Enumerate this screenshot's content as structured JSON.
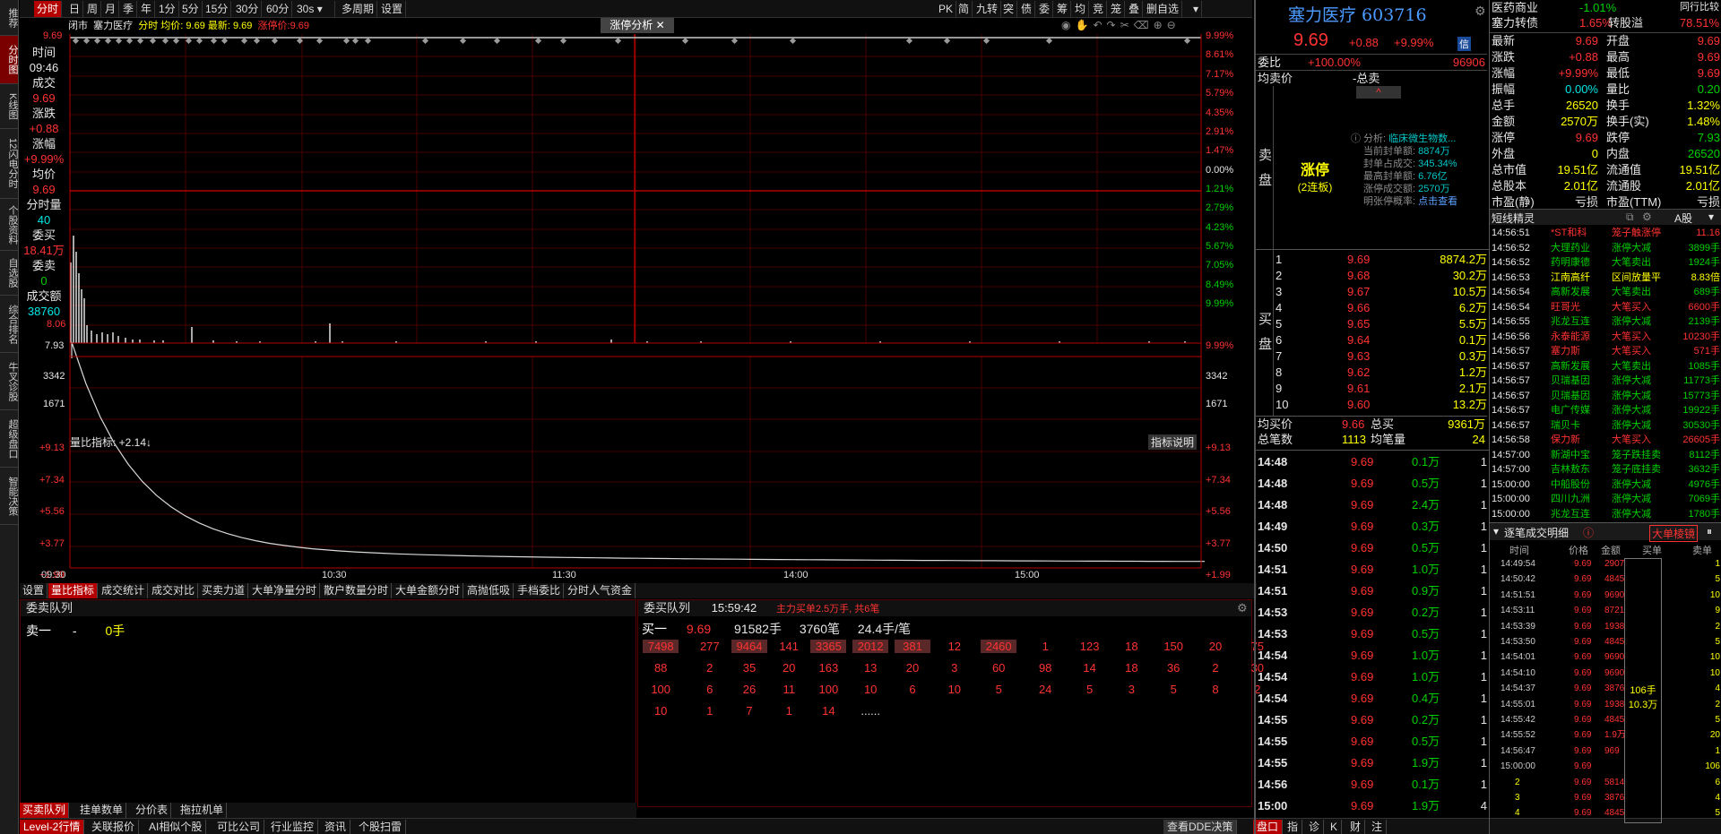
{
  "left_sidebar": [
    "推荐",
    "分时图",
    "K线图",
    "12闪电分时",
    "个股资料",
    "自选股",
    "综合排名",
    "牛叉诊股",
    "超级盘口",
    "智能决策"
  ],
  "toolbar": {
    "periods": [
      "分时",
      "日",
      "周",
      "月",
      "季",
      "年",
      "1分",
      "5分",
      "15分",
      "30分",
      "60分",
      "30s",
      "多周期",
      "设置"
    ],
    "active": "分时",
    "right": [
      "PK",
      "简",
      "九转",
      "突",
      "债",
      "委",
      "筹",
      "均",
      "竞",
      "笼",
      "叠",
      "删自选"
    ]
  },
  "chart_header": {
    "market": "闭市",
    "name": "塞力医疗",
    "items": "分时 均价: 9.69 最新: 9.69",
    "limit": "涨停价:9.69",
    "badge": "涨停分析"
  },
  "cursor_panel": {
    "time_label": "时间",
    "time": "09:46",
    "deal_label": "成交",
    "deal": "9.69",
    "chg_label": "涨跌",
    "chg": "+0.88",
    "pct_label": "涨幅",
    "pct": "+9.99%",
    "avg_label": "均价",
    "avg": "9.69",
    "vol_label": "分时量",
    "vol": "40",
    "buyq_label": "委买",
    "buyq": "18.41万",
    "sellq_label": "委卖",
    "sellq": "0",
    "amt_label": "成交额",
    "amt": "38760"
  },
  "price_axis_left": [
    "9.69",
    "8.06"
  ],
  "price_axis_right": [
    "9.99%",
    "8.61%",
    "7.17%",
    "5.79%",
    "4.35%",
    "2.91%",
    "1.47%",
    "0.00%",
    "1.21%",
    "2.79%",
    "4.23%",
    "5.67%",
    "7.05%",
    "8.49%",
    "9.99%"
  ],
  "volume_axis": [
    "7.93",
    "3342",
    "1671"
  ],
  "volume_axis_right": [
    "9.99%",
    "3342",
    "1671"
  ],
  "indicator": {
    "label": "量比指标: +2.14↓",
    "help": "指标说明",
    "levels": [
      "+9.13",
      "+7.34",
      "+5.56",
      "+3.77",
      "+1.99"
    ]
  },
  "time_axis": [
    "09:30",
    "10:30",
    "11:30",
    "14:00",
    "15:00"
  ],
  "chart_data": {
    "type": "line",
    "x": [
      "09:30",
      "10:30",
      "11:30",
      "14:00",
      "15:00"
    ],
    "series": [
      {
        "values": [
          9.69,
          9.69,
          9.69,
          9.69,
          9.69
        ]
      }
    ],
    "ylim": [
      8.06,
      9.69
    ],
    "grid": true
  },
  "indicator_tabs": [
    "设置",
    "量比指标",
    "成交统计",
    "成交对比",
    "买卖力道",
    "大单净量分时",
    "散户数量分时",
    "大单金额分时",
    "高抛低吸",
    "手档委比",
    "分时人气资金"
  ],
  "sell_queue": {
    "title": "委卖队列",
    "row_label": "卖一",
    "price": "-",
    "qty": "0手"
  },
  "buy_queue": {
    "title": "委买队列",
    "time": "15:59:42",
    "note": "主力买单2.5万手, 共6笔",
    "head": [
      "买一",
      "9.69",
      "91582手",
      "3760笔",
      "24.4手/笔"
    ],
    "rows": [
      [
        "7498",
        "277",
        "9464",
        "141",
        "3365",
        "2012",
        "381",
        "12",
        "2460",
        "1",
        "123",
        "18",
        "150",
        "20",
        "75"
      ],
      [
        "88",
        "2",
        "35",
        "20",
        "163",
        "13",
        "20",
        "3",
        "60",
        "98",
        "14",
        "18",
        "36",
        "2",
        "30"
      ],
      [
        "100",
        "6",
        "26",
        "11",
        "100",
        "10",
        "6",
        "10",
        "5",
        "24",
        "5",
        "3",
        "5",
        "8",
        "2"
      ],
      [
        "10",
        "1",
        "7",
        "1",
        "14",
        "......"
      ]
    ]
  },
  "bottom_tabs": [
    "买卖队列",
    "挂单数单",
    "分价表",
    "拖拉机单"
  ],
  "status_bar": [
    "Level-2行情",
    "关联报价",
    "AI相似个股",
    "可比公司",
    "行业监控",
    "资讯",
    "个股扫雷"
  ],
  "status_right": [
    "查看DDE决策",
    "盘口",
    "指",
    "诊",
    "K",
    "财",
    "注"
  ],
  "quote": {
    "name": "塞力医疗 603716",
    "price": "9.69",
    "chg": "+0.88",
    "pct": "+9.99%",
    "tag": "信",
    "weibi_label": "委比",
    "weibi": "+100.00%",
    "weicha": "96906",
    "jmj_label": "均卖价",
    "total_sell": "-总卖",
    "limit_up": "涨停",
    "limit_days": "(2连板)",
    "analysis": [
      [
        "分析:",
        "临床微生物数..."
      ],
      [
        "当前封单额:",
        "8874万"
      ],
      [
        "封单占成交:",
        "345.34%"
      ],
      [
        "最高封单额:",
        "6.76亿"
      ],
      [
        "涨停成交额:",
        "2570万"
      ],
      [
        "明张停概率:",
        "点击查看"
      ]
    ],
    "sell_side_label": "卖盘",
    "buy_side_label": "买盘",
    "buys": [
      [
        "1",
        "9.69",
        "8874.2万"
      ],
      [
        "2",
        "9.68",
        "30.2万"
      ],
      [
        "3",
        "9.67",
        "10.5万"
      ],
      [
        "4",
        "9.66",
        "6.2万"
      ],
      [
        "5",
        "9.65",
        "5.5万"
      ],
      [
        "6",
        "9.64",
        "0.1万"
      ],
      [
        "7",
        "9.63",
        "0.3万"
      ],
      [
        "8",
        "9.62",
        "1.2万"
      ],
      [
        "9",
        "9.61",
        "2.1万"
      ],
      [
        "10",
        "9.60",
        "13.2万"
      ]
    ],
    "avg_buy_label": "均买价",
    "avg_buy": "9.66",
    "total_buy_label": "总买",
    "total_buy": "9361万",
    "deals_label": "总笔数",
    "deals": "1113",
    "avg_vol_label": "均笔量",
    "avg_vol": "24",
    "ticks": [
      [
        "14:48",
        "9.69",
        "0.1万",
        "1"
      ],
      [
        "14:48",
        "9.69",
        "0.5万",
        "1"
      ],
      [
        "14:48",
        "9.69",
        "2.4万",
        "1"
      ],
      [
        "14:49",
        "9.69",
        "0.3万",
        "1"
      ],
      [
        "14:50",
        "9.69",
        "0.5万",
        "1"
      ],
      [
        "14:51",
        "9.69",
        "1.0万",
        "1"
      ],
      [
        "14:51",
        "9.69",
        "0.9万",
        "1"
      ],
      [
        "14:53",
        "9.69",
        "0.2万",
        "1"
      ],
      [
        "14:53",
        "9.69",
        "0.5万",
        "1"
      ],
      [
        "14:54",
        "9.69",
        "1.0万",
        "1"
      ],
      [
        "14:54",
        "9.69",
        "1.0万",
        "1"
      ],
      [
        "14:54",
        "9.69",
        "0.4万",
        "1"
      ],
      [
        "14:55",
        "9.69",
        "0.2万",
        "1"
      ],
      [
        "14:55",
        "9.69",
        "0.5万",
        "1"
      ],
      [
        "14:55",
        "9.69",
        "1.9万",
        "1"
      ],
      [
        "14:56",
        "9.69",
        "0.1万",
        "1"
      ],
      [
        "15:00",
        "9.69",
        "1.9万",
        "4"
      ]
    ]
  },
  "stats": {
    "top": [
      [
        "医药商业",
        "-1.01%",
        "同行比较"
      ],
      [
        "塞力转债",
        "1.65%",
        "转股溢",
        "78.51%"
      ]
    ],
    "rows": [
      [
        "最新",
        "9.69",
        "开盘",
        "9.69"
      ],
      [
        "涨跌",
        "+0.88",
        "最高",
        "9.69"
      ],
      [
        "涨幅",
        "+9.99%",
        "最低",
        "9.69"
      ],
      [
        "振幅",
        "0.00%",
        "量比",
        "0.20"
      ],
      [
        "总手",
        "26520",
        "换手",
        "1.32%"
      ],
      [
        "金额",
        "2570万",
        "换手(实)",
        "1.48%"
      ],
      [
        "涨停",
        "9.69",
        "跌停",
        "7.93"
      ],
      [
        "外盘",
        "0",
        "内盘",
        "26520"
      ],
      [
        "总市值",
        "19.51亿",
        "流通值",
        "19.51亿"
      ],
      [
        "总股本",
        "2.01亿",
        "流通股",
        "2.01亿"
      ],
      [
        "市盈(静)",
        "亏损",
        "市盈(TTM)",
        "亏损"
      ]
    ]
  },
  "short_wizard": {
    "title": "短线精灵",
    "filter": "A股",
    "rows": [
      [
        "14:56:51",
        "*ST和科",
        "笼子触涨停",
        "11.16"
      ],
      [
        "14:56:52",
        "大理药业",
        "涨停大减",
        "3899手"
      ],
      [
        "14:56:52",
        "药明康德",
        "大笔卖出",
        "1924手"
      ],
      [
        "14:56:53",
        "江南高纤",
        "区间放量平",
        "8.83倍"
      ],
      [
        "14:56:54",
        "高新发展",
        "大笔卖出",
        "689手"
      ],
      [
        "14:56:54",
        "旺哥光",
        "大笔买入",
        "6600手"
      ],
      [
        "14:56:55",
        "兆龙互连",
        "涨停大减",
        "2139手"
      ],
      [
        "14:56:56",
        "永泰能源",
        "大笔买入",
        "10230手"
      ],
      [
        "14:56:57",
        "塞力斯",
        "大笔买入",
        "571手"
      ],
      [
        "14:56:57",
        "高新发展",
        "大笔卖出",
        "1085手"
      ],
      [
        "14:56:57",
        "贝瑞基因",
        "涨停大减",
        "11773手"
      ],
      [
        "14:56:57",
        "贝瑞基因",
        "涨停大减",
        "15773手"
      ],
      [
        "14:56:57",
        "电广传媒",
        "涨停大减",
        "19922手"
      ],
      [
        "14:56:57",
        "瑞贝卡",
        "涨停大减",
        "30530手"
      ],
      [
        "14:56:58",
        "保力新",
        "大笔买入",
        "26605手"
      ],
      [
        "14:57:00",
        "新湖中宝",
        "笼子跌挂卖",
        "8112手"
      ],
      [
        "14:57:00",
        "吉林敖东",
        "笼子底挂卖",
        "3632手"
      ],
      [
        "15:00:00",
        "中船股份",
        "涨停大减",
        "4976手"
      ],
      [
        "15:00:00",
        "四川九洲",
        "涨停大减",
        "7069手"
      ],
      [
        "15:00:00",
        "兆龙互连",
        "涨停大减",
        "1780手"
      ]
    ]
  },
  "tick_detail": {
    "title": "逐笔成交明细",
    "btn": "大单棱镜",
    "headers": [
      "时间",
      "价格",
      "金额",
      "买单",
      "卖单"
    ],
    "rows": [
      [
        "14:49:54",
        "9.69",
        "2907",
        "1"
      ],
      [
        "14:50:42",
        "9.69",
        "4845",
        "5"
      ],
      [
        "14:51:51",
        "9.69",
        "9690",
        "10"
      ],
      [
        "14:53:11",
        "9.69",
        "8721",
        "9"
      ],
      [
        "14:53:39",
        "9.69",
        "1938",
        "2"
      ],
      [
        "14:53:50",
        "9.69",
        "4845",
        "5"
      ],
      [
        "14:54:01",
        "9.69",
        "9690",
        "10"
      ],
      [
        "14:54:10",
        "9.69",
        "9690",
        "10"
      ],
      [
        "14:54:37",
        "9.69",
        "3876",
        "4"
      ],
      [
        "14:55:01",
        "9.69",
        "1938",
        "2"
      ],
      [
        "14:55:42",
        "9.69",
        "4845",
        "5"
      ],
      [
        "14:55:52",
        "9.69",
        "1.9万",
        "20"
      ],
      [
        "14:56:47",
        "9.69",
        "969",
        "1"
      ],
      [
        "15:00:00",
        "9.69",
        "",
        "106"
      ],
      [
        "2",
        "9.69",
        "5814",
        "6"
      ],
      [
        "3",
        "9.69",
        "3876",
        "4"
      ],
      [
        "4",
        "9.69",
        "4845",
        "5"
      ]
    ],
    "big_order": "106手",
    "big_amount": "10.3万"
  }
}
